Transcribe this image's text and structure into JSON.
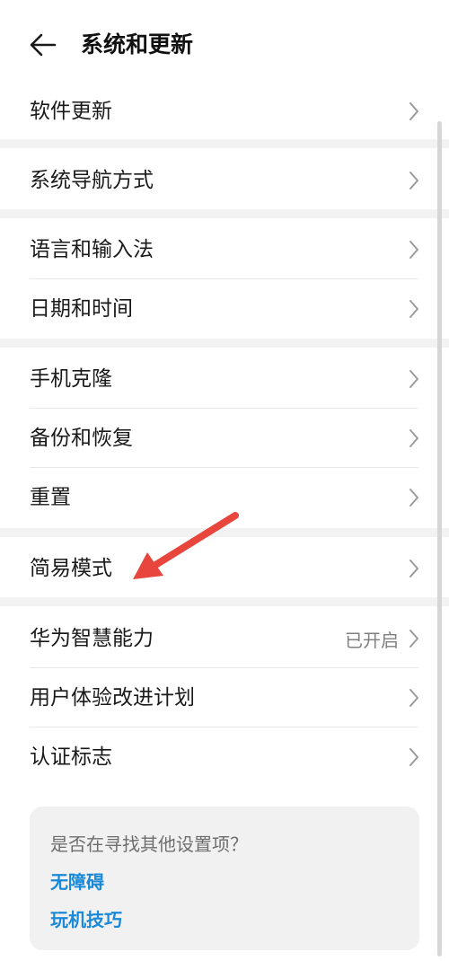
{
  "header": {
    "title": "系统和更新",
    "back_icon": "arrow-left-icon"
  },
  "groups": [
    {
      "items": [
        {
          "label": "软件更新"
        }
      ]
    },
    {
      "items": [
        {
          "label": "系统导航方式"
        }
      ]
    },
    {
      "items": [
        {
          "label": "语言和输入法"
        },
        {
          "label": "日期和时间"
        }
      ]
    },
    {
      "items": [
        {
          "label": "手机克隆"
        },
        {
          "label": "备份和恢复"
        },
        {
          "label": "重置"
        }
      ]
    },
    {
      "items": [
        {
          "label": "简易模式"
        }
      ]
    },
    {
      "items": [
        {
          "label": "华为智慧能力",
          "value": "已开启"
        },
        {
          "label": "用户体验改进计划"
        },
        {
          "label": "认证标志"
        }
      ]
    }
  ],
  "suggestions": {
    "question": "是否在寻找其他设置项？",
    "links": [
      "无障碍",
      "玩机技巧"
    ]
  },
  "annotation": {
    "color": "#e8453c"
  },
  "colors": {
    "link": "#1a8ad8",
    "separator": "#f2f2f2",
    "chevron": "#9a9a9a"
  }
}
